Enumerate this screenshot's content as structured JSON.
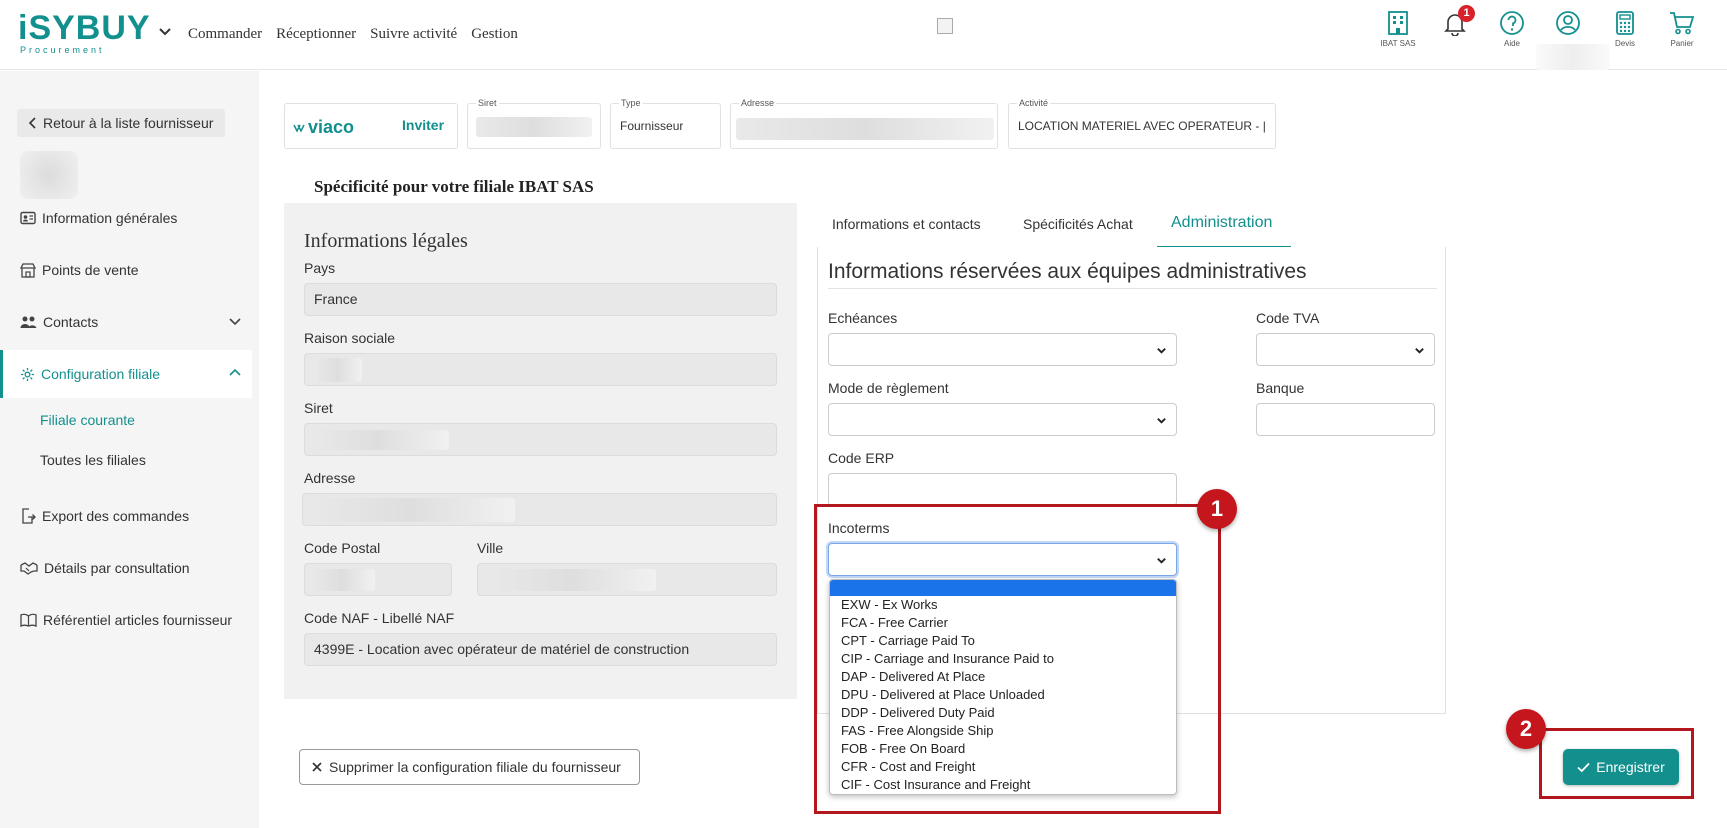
{
  "app": {
    "logo_main": "iSYBUY",
    "logo_sub": "Procurement"
  },
  "topnav": [
    "Commander",
    "Réceptionner",
    "Suivre activité",
    "Gestion"
  ],
  "topicons": {
    "company_label": "IBAT SAS",
    "notifications_count": "1",
    "help_label": "Aide",
    "quotes_label": "Devis",
    "cart_label": "Panier"
  },
  "sidebar": {
    "back_label": "Retour à la liste fournisseur",
    "items": [
      {
        "label": "Information générales",
        "icon": "id-card-icon"
      },
      {
        "label": "Points de vente",
        "icon": "store-icon"
      },
      {
        "label": "Contacts",
        "icon": "users-icon"
      },
      {
        "label": "Configuration filiale",
        "icon": "gear-icon"
      },
      {
        "label": "Export des commandes",
        "icon": "export-icon"
      },
      {
        "label": "Détails par consultation",
        "icon": "handshake-icon"
      },
      {
        "label": "Référentiel articles fournisseur",
        "icon": "book-icon"
      }
    ],
    "subitems": [
      "Filiale courante",
      "Toutes les filiales"
    ]
  },
  "header": {
    "brand": "viaco",
    "invite_label": "Inviter",
    "siret_caption": "Siret",
    "type_caption": "Type",
    "type_value": "Fournisseur",
    "address_caption": "Adresse",
    "activity_caption": "Activité",
    "activity_value": "LOCATION MATERIEL AVEC OPERATEUR - | N..."
  },
  "spec_title": "Spécificité pour votre filiale IBAT SAS",
  "legal": {
    "title": "Informations légales",
    "pays_label": "Pays",
    "pays_value": "France",
    "raison_label": "Raison sociale",
    "siret_label": "Siret",
    "adresse_label": "Adresse",
    "cp_label": "Code Postal",
    "ville_label": "Ville",
    "naf_label": "Code NAF - Libellé NAF",
    "naf_value": "4399E - Location avec opérateur de matériel de construction"
  },
  "tabs": [
    {
      "label": "Informations et contacts"
    },
    {
      "label": "Spécificités Achat"
    },
    {
      "label": "Administration"
    }
  ],
  "admin": {
    "title": "Informations réservées aux équipes administratives",
    "echeances_label": "Echéances",
    "code_tva_label": "Code TVA",
    "mode_label": "Mode de règlement",
    "banque_label": "Banque",
    "code_erp_label": "Code ERP",
    "incoterms_label": "Incoterms"
  },
  "incoterms_options": [
    "EXW - Ex Works",
    "FCA - Free Carrier",
    "CPT - Carriage Paid To",
    "CIP - Carriage and Insurance Paid to",
    "DAP - Delivered At Place",
    "DPU - Delivered at Place Unloaded",
    "DDP - Delivered Duty Paid",
    "FAS - Free Alongside Ship",
    "FOB - Free On Board",
    "CFR - Cost and Freight",
    "CIF - Cost Insurance and Freight"
  ],
  "callouts": [
    "1",
    "2"
  ],
  "actions": {
    "delete_label": "Supprimer la configuration filiale du fournisseur",
    "save_label": "Enregistrer"
  },
  "colors": {
    "accent": "#13908e",
    "callout": "#c5161d",
    "dropdown_highlight": "#1a73e8"
  }
}
